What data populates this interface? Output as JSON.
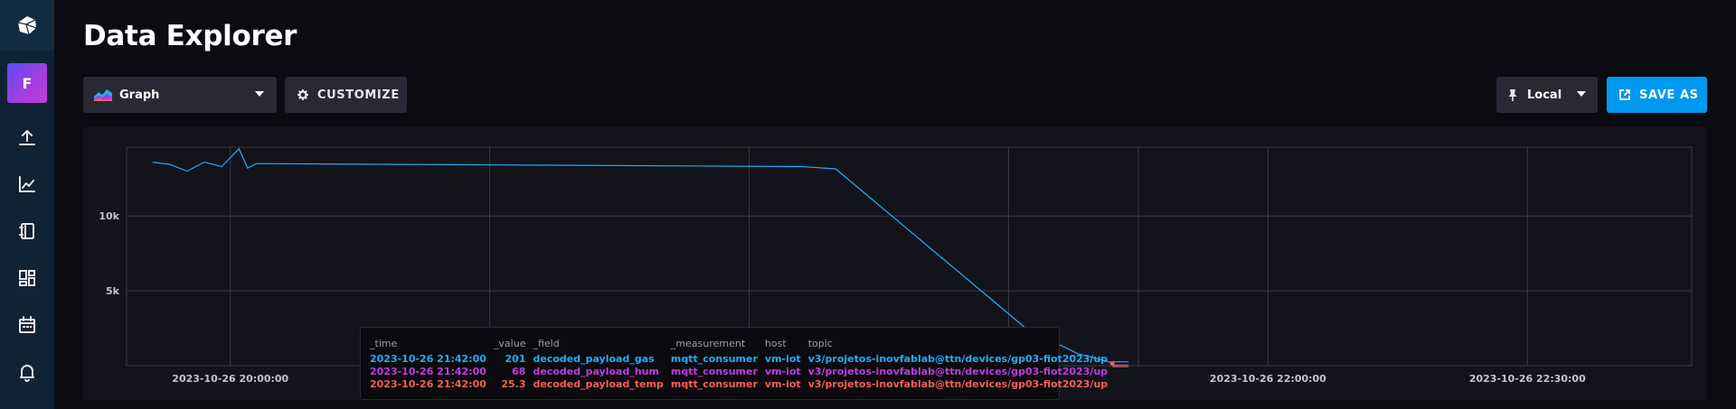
{
  "app": {
    "page_title": "Data Explorer"
  },
  "sidebar": {
    "org_initial": "F",
    "items": [
      {
        "icon": "upload-icon"
      },
      {
        "icon": "graph-icon"
      },
      {
        "icon": "notebook-icon"
      },
      {
        "icon": "dashboards-icon"
      },
      {
        "icon": "calendar-icon"
      },
      {
        "icon": "bell-icon"
      }
    ]
  },
  "toolbar": {
    "vis_type_label": "Graph",
    "customize_label": "CUSTOMIZE",
    "timezone_label": "Local",
    "save_label": "SAVE AS"
  },
  "colors": {
    "accent": "#0098f0",
    "series_gas": "#22adf6",
    "series_hum": "#bf3dde",
    "series_temp": "#f95f53"
  },
  "chart_data": {
    "type": "line",
    "y_ticks": [
      "10k",
      "5k"
    ],
    "x_ticks": [
      "2023-10-26 20:00:00",
      "2023-10-26 22:00:00",
      "2023-10-26 22:30:00"
    ],
    "series": [
      {
        "color": "#22adf6",
        "x": [
          "2023-10-26 19:51",
          "2023-10-26 19:53",
          "2023-10-26 19:55",
          "2023-10-26 19:57",
          "2023-10-26 19:59",
          "2023-10-26 20:01",
          "2023-10-26 20:02",
          "2023-10-26 20:03",
          "2023-10-26 21:06",
          "2023-10-26 21:10",
          "2023-10-26 21:32",
          "2023-10-26 21:38",
          "2023-10-26 21:42"
        ],
        "y": [
          13600,
          13450,
          13000,
          13600,
          13300,
          14500,
          13200,
          13500,
          13300,
          13150,
          2500,
          800,
          201
        ]
      }
    ]
  },
  "tooltip": {
    "headers": [
      "_time",
      "_value",
      "_field",
      "_measurement",
      "host",
      "topic"
    ],
    "rows": [
      {
        "time": "2023-10-26 21:42:00",
        "value": "201",
        "field": "decoded_payload_gas",
        "measurement": "mqtt_consumer",
        "host": "vm-iot",
        "topic": "v3/projetos-inovfablab@ttn/devices/gp03-fiot2023/up",
        "color": "#22adf6"
      },
      {
        "time": "2023-10-26 21:42:00",
        "value": "68",
        "field": "decoded_payload_hum",
        "measurement": "mqtt_consumer",
        "host": "vm-iot",
        "topic": "v3/projetos-inovfablab@ttn/devices/gp03-fiot2023/up",
        "color": "#bf3dde"
      },
      {
        "time": "2023-10-26 21:42:00",
        "value": "25.3",
        "field": "decoded_payload_temp",
        "measurement": "mqtt_consumer",
        "host": "vm-iot",
        "topic": "v3/projetos-inovfablab@ttn/devices/gp03-fiot2023/up",
        "color": "#f95f53"
      }
    ]
  }
}
